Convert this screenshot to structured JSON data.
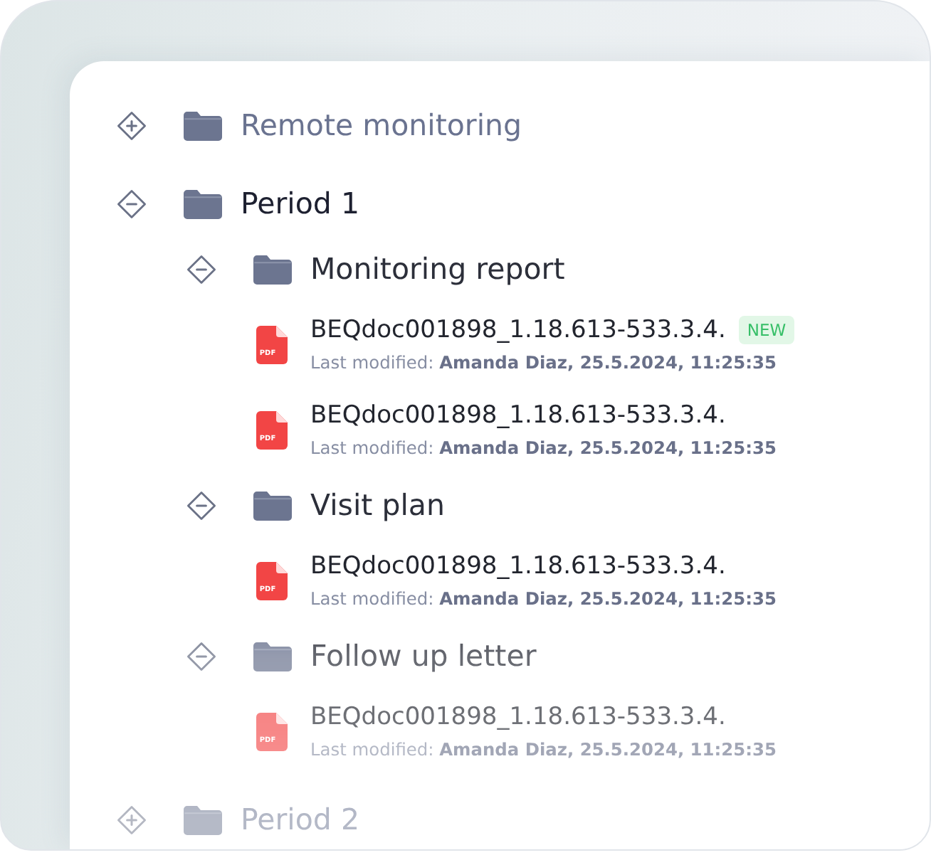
{
  "tree": [
    {
      "kind": "folder",
      "label": "Remote monitoring",
      "expanded": false
    },
    {
      "kind": "folder",
      "label": "Period 1",
      "expanded": true,
      "children": [
        {
          "kind": "folder",
          "label": "Monitoring report",
          "expanded": true,
          "children": [
            {
              "kind": "file",
              "file_type": "PDF",
              "name": "BEQdoc001898_1.18.613-533.3.4.",
              "badge": "NEW",
              "modified": "Last modified: **Amanda Diaz, 25.5.2024, 11:25:35**"
            },
            {
              "kind": "file",
              "file_type": "PDF",
              "name": "BEQdoc001898_1.18.613-533.3.4.",
              "modified": "Last modified: **Amanda Diaz, 25.5.2024, 11:25:35**"
            }
          ]
        },
        {
          "kind": "folder",
          "label": "Visit plan",
          "expanded": true,
          "children": [
            {
              "kind": "file",
              "file_type": "PDF",
              "name": "BEQdoc001898_1.18.613-533.3.4.",
              "modified": "Last modified: **Amanda Diaz, 25.5.2024, 11:25:35**"
            }
          ]
        },
        {
          "kind": "folder",
          "label": "Follow up letter",
          "expanded": true,
          "children": [
            {
              "kind": "file",
              "file_type": "PDF",
              "name": "BEQdoc001898_1.18.613-533.3.4.",
              "modified": "Last modified: **Amanda Diaz, 25.5.2024, 11:25:35**"
            }
          ]
        }
      ]
    },
    {
      "kind": "folder",
      "label": "Period 2",
      "expanded": false
    }
  ]
}
